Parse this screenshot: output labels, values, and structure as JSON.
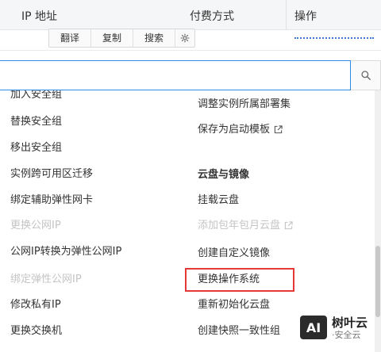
{
  "table": {
    "header": {
      "ip": "IP 地址",
      "billing": "付费方式",
      "actions": "操作"
    }
  },
  "toolbar": {
    "translate": "翻译",
    "copy": "复制",
    "search": "搜索",
    "settings_icon": "gear-icon"
  },
  "search": {
    "value": "",
    "placeholder": "",
    "icon": "search-icon"
  },
  "menu": {
    "left": [
      {
        "label": "加入安全组",
        "disabled": false
      },
      {
        "label": "替换安全组",
        "disabled": false
      },
      {
        "label": "移出安全组",
        "disabled": false
      },
      {
        "label": "实例跨可用区迁移",
        "disabled": false
      },
      {
        "label": "绑定辅助弹性网卡",
        "disabled": false
      },
      {
        "label": "更换公网IP",
        "disabled": true
      },
      {
        "label": "公网IP转换为弹性公网IP",
        "disabled": false
      },
      {
        "label": "绑定弹性公网IP",
        "disabled": true
      },
      {
        "label": "修改私有IP",
        "disabled": false
      },
      {
        "label": "更换交换机",
        "disabled": false
      }
    ],
    "right": [
      {
        "label": "调整实例所属部署集",
        "disabled": false
      },
      {
        "label": "保存为启动模板",
        "disabled": false,
        "external": true
      },
      {
        "label": "云盘与镜像",
        "heading": true
      },
      {
        "label": "挂载云盘",
        "disabled": false
      },
      {
        "label": "添加包年包月云盘",
        "disabled": true,
        "external": true
      },
      {
        "label": "创建自定义镜像",
        "disabled": false
      },
      {
        "label": "更换操作系统",
        "disabled": false,
        "highlighted": true
      },
      {
        "label": "重新初始化云盘",
        "disabled": false
      },
      {
        "label": "创建快照一致性组",
        "disabled": false
      }
    ]
  },
  "watermark": {
    "badge": "AI",
    "title": "树叶云",
    "subtitle": "·安全云"
  },
  "colors": {
    "highlight": "#e53935",
    "focus_border": "#2f8be6",
    "disabled_text": "#c4c4c4"
  }
}
